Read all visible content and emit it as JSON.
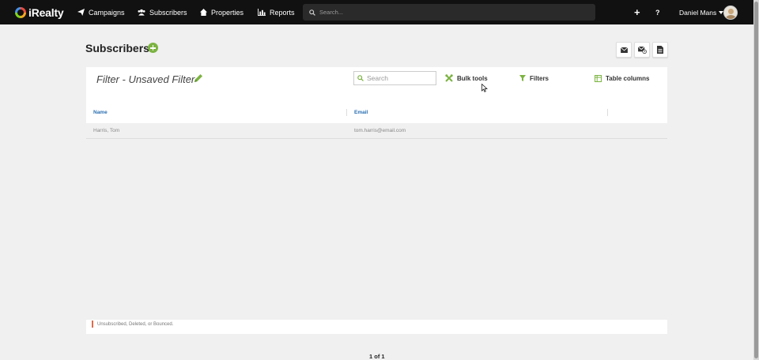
{
  "app": {
    "logo_text": "iRealty"
  },
  "nav": {
    "items": [
      {
        "label": "Campaigns",
        "icon": "paper-plane-icon"
      },
      {
        "label": "Subscribers",
        "icon": "users-icon"
      },
      {
        "label": "Properties",
        "icon": "home-icon"
      },
      {
        "label": "Reports",
        "icon": "bar-chart-icon"
      }
    ],
    "search_placeholder": "Search...",
    "plus": "+",
    "help": "?",
    "user_name": "Daniel Mans"
  },
  "page": {
    "title": "Subscribers"
  },
  "card": {
    "filter_title": "Filter - Unsaved Filter",
    "search_placeholder": "Search",
    "bulk_tools": "Bulk tools",
    "filters": "Filters",
    "table_columns": "Table columns"
  },
  "table": {
    "columns": [
      "Name",
      "Email"
    ],
    "rows": [
      {
        "name": "Harris, Tom",
        "email": "tom.harris@email.com"
      }
    ]
  },
  "legend": {
    "text": "Unsubscribed, Deleted, or Bounced."
  },
  "pager": {
    "text": "1 of 1"
  },
  "colors": {
    "accent_green": "#7cb342",
    "link_blue": "#2a6fb0",
    "status_red": "#e06a4a",
    "navbar": "#111111"
  }
}
